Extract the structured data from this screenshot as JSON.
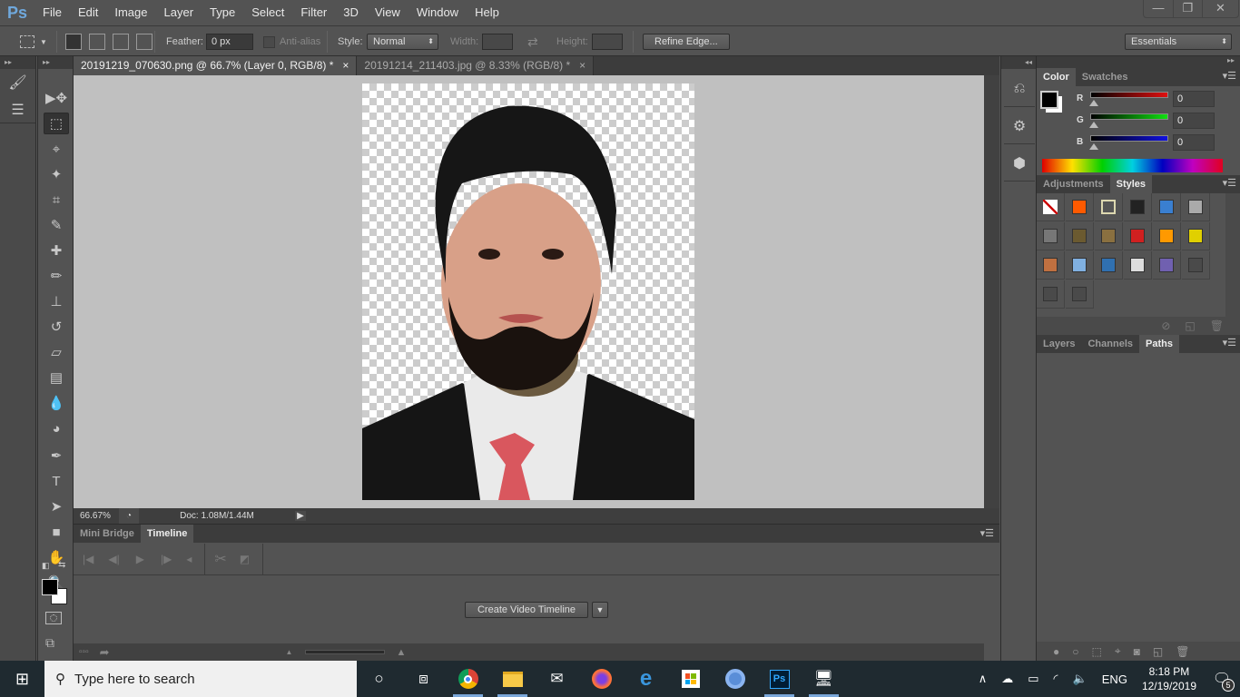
{
  "app": {
    "logo": "Ps",
    "menu": [
      "File",
      "Edit",
      "Image",
      "Layer",
      "Type",
      "Select",
      "Filter",
      "3D",
      "View",
      "Window",
      "Help"
    ],
    "window_controls": {
      "minimize": "—",
      "restore": "❐",
      "close": "✕"
    }
  },
  "options": {
    "feather_label": "Feather:",
    "feather_value": "0 px",
    "antialias_label": "Anti-alias",
    "style_label": "Style:",
    "style_value": "Normal",
    "width_label": "Width:",
    "height_label": "Height:",
    "refine_edge": "Refine Edge...",
    "workspace": "Essentials"
  },
  "tabs": [
    {
      "title": "20191219_070630.png @ 66.7% (Layer 0, RGB/8) *",
      "close": "×"
    },
    {
      "title": "20191214_211403.jpg @ 8.33% (RGB/8) *",
      "close": "×"
    }
  ],
  "tools": [
    {
      "name": "move-tool",
      "glyph": "▶✥"
    },
    {
      "name": "rectangular-marquee-tool",
      "glyph": "⬚"
    },
    {
      "name": "lasso-tool",
      "glyph": "⌖"
    },
    {
      "name": "magic-wand-tool",
      "glyph": "✦"
    },
    {
      "name": "crop-tool",
      "glyph": "⌗"
    },
    {
      "name": "eyedropper-tool",
      "glyph": "✎"
    },
    {
      "name": "healing-brush-tool",
      "glyph": "✚"
    },
    {
      "name": "brush-tool",
      "glyph": "✏"
    },
    {
      "name": "clone-stamp-tool",
      "glyph": "⊥"
    },
    {
      "name": "history-brush-tool",
      "glyph": "↺"
    },
    {
      "name": "eraser-tool",
      "glyph": "▱"
    },
    {
      "name": "gradient-tool",
      "glyph": "▤"
    },
    {
      "name": "blur-tool",
      "glyph": "💧"
    },
    {
      "name": "dodge-tool",
      "glyph": "◕"
    },
    {
      "name": "pen-tool",
      "glyph": "✒"
    },
    {
      "name": "type-tool",
      "glyph": "T"
    },
    {
      "name": "path-selection-tool",
      "glyph": "➤"
    },
    {
      "name": "rectangle-tool",
      "glyph": "■"
    },
    {
      "name": "hand-tool",
      "glyph": "✋"
    },
    {
      "name": "zoom-tool",
      "glyph": "🔍"
    }
  ],
  "status": {
    "zoom": "66.67%",
    "doc": "Doc: 1.08M/1.44M"
  },
  "timeline": {
    "tabs": [
      "Mini Bridge",
      "Timeline"
    ],
    "active": "Timeline",
    "create_button": "Create Video Timeline"
  },
  "color_panel": {
    "tabs": [
      "Color",
      "Swatches"
    ],
    "active": "Color",
    "channels": [
      {
        "label": "R",
        "value": "0",
        "color": "#e01010"
      },
      {
        "label": "G",
        "value": "0",
        "color": "#10e010"
      },
      {
        "label": "B",
        "value": "0",
        "color": "#1010e0"
      }
    ],
    "foreground": "#000000",
    "background": "#ffffff"
  },
  "styles_panel": {
    "tabs": [
      "Adjustments",
      "Styles"
    ],
    "active": "Styles",
    "swatches": [
      "none",
      "#ff5a00",
      "#555555",
      "#222222",
      "#3a7fd0",
      "#aaaaaa",
      "#777777",
      "#6b5a30",
      "#8a7040",
      "#d02020",
      "#ff9900",
      "#e0d000",
      "#c07040",
      "#80b0e0",
      "#3070b0",
      "#dddddd",
      "#7060b0",
      "#4a4a4a",
      "#4a4a4a",
      "#4a4a4a"
    ]
  },
  "layers_panel": {
    "tabs": [
      "Layers",
      "Channels",
      "Paths"
    ],
    "active": "Paths"
  },
  "taskbar": {
    "search_placeholder": "Type here to search",
    "time": "8:18 PM",
    "date": "12/19/2019",
    "lang": "ENG",
    "notifications": "5"
  }
}
